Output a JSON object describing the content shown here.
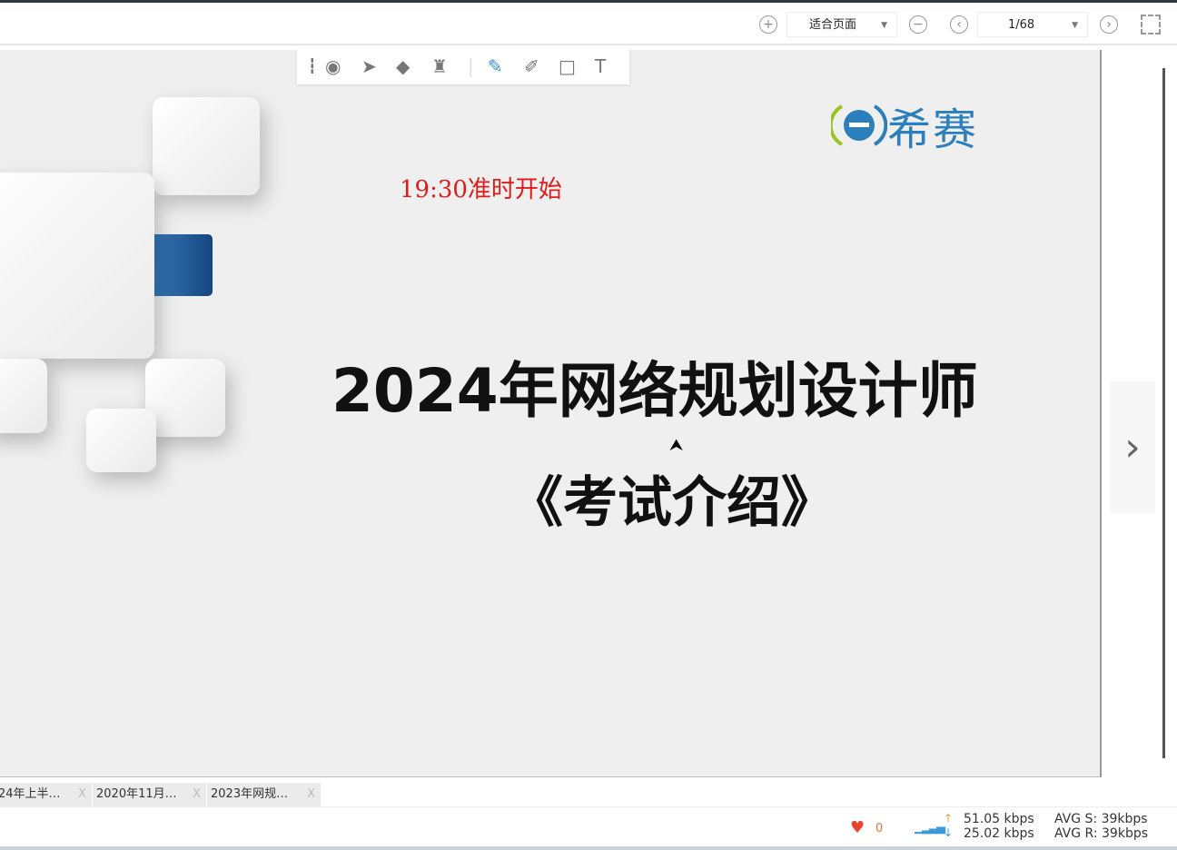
{
  "toolbar": {
    "zoom_in": "+",
    "zoom_select": "适合页面",
    "zoom_out": "−",
    "prev_page": "‹",
    "page_select": "1/68",
    "next_page": "›"
  },
  "annotation_tools": [
    "laser",
    "select",
    "eraser",
    "clear",
    "pen",
    "highlighter",
    "rectangle",
    "text"
  ],
  "slide": {
    "logo_text": "希赛",
    "start_time": "19:30准时开始",
    "title": "2024年网络规划设计师",
    "subtitle": "《考试介绍》"
  },
  "tabs": [
    {
      "label": "24年上半…",
      "close": "X"
    },
    {
      "label": "2020年11月…",
      "close": "X"
    },
    {
      "label": "2023年网规…",
      "close": "X"
    }
  ],
  "status": {
    "likes": "0",
    "upload": "51.05 kbps",
    "download": "25.02 kbps",
    "avg_s": "AVG S: 39kbps",
    "avg_r": "AVG R: 39kbps"
  },
  "colors": {
    "accent": "#2c7fbd",
    "start_red": "#e01b1b"
  }
}
